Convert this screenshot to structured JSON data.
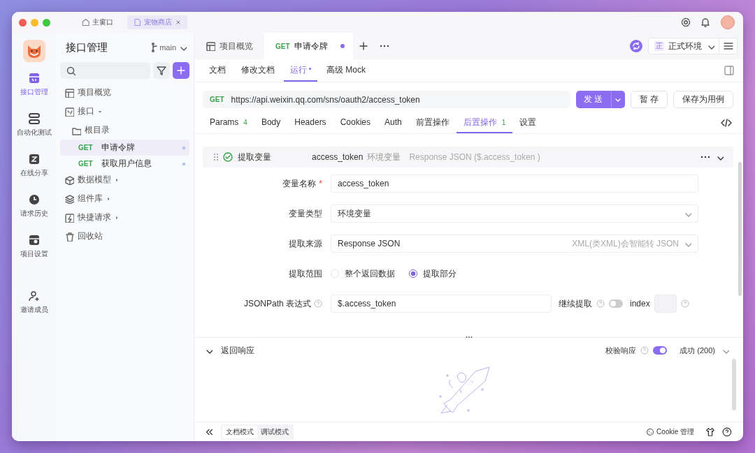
{
  "window": {
    "tabs": [
      {
        "label": "主窗口",
        "selected": false,
        "closable": false
      },
      {
        "label": "宠物商店",
        "selected": true,
        "closable": true
      }
    ]
  },
  "rail": {
    "items": [
      {
        "label": "接口管理",
        "selected": true
      },
      {
        "label": "自动化测试",
        "selected": false
      },
      {
        "label": "在线分享",
        "selected": false
      },
      {
        "label": "请求历史",
        "selected": false
      },
      {
        "label": "项目设置",
        "selected": false
      },
      {
        "label": "邀请成员",
        "selected": false
      }
    ]
  },
  "sidebar": {
    "title": "接口管理",
    "branch": "main",
    "tree": [
      {
        "kind": "overview",
        "label": "项目概览"
      },
      {
        "kind": "api",
        "label": "接口",
        "expanded": true,
        "children": [
          {
            "kind": "folder",
            "label": "根目录",
            "expanded": true,
            "children": [
              {
                "kind": "request",
                "method": "GET",
                "label": "申请令牌",
                "selected": true
              },
              {
                "kind": "request",
                "method": "GET",
                "label": "获取用户信息",
                "selected": false
              }
            ]
          }
        ]
      },
      {
        "kind": "model",
        "label": "数据模型",
        "expanded": false
      },
      {
        "kind": "component",
        "label": "组件库",
        "expanded": false
      },
      {
        "kind": "quick",
        "label": "快捷请求",
        "expanded": false
      },
      {
        "kind": "trash",
        "label": "回收站"
      }
    ]
  },
  "editor_tabs": [
    {
      "label": "项目概览",
      "selected": false,
      "modified": false
    },
    {
      "method": "GET",
      "label": "申请令牌",
      "selected": true,
      "modified": true
    }
  ],
  "environment": "正式环境",
  "environment_badge": "正",
  "sub_tabs": [
    {
      "label": "文档",
      "selected": false,
      "modified": false
    },
    {
      "label": "修改文档",
      "selected": false,
      "modified": false
    },
    {
      "label": "运行",
      "selected": true,
      "modified": true
    },
    {
      "label": "高级 Mock",
      "selected": false,
      "modified": false
    }
  ],
  "request": {
    "method": "GET",
    "url": "https://api.weixin.qq.com/sns/oauth2/access_token",
    "send": "发 送",
    "stash": "暂 存",
    "save_case": "保存为用例"
  },
  "request_tabs": [
    {
      "label": "Params",
      "count": "4",
      "selected": false
    },
    {
      "label": "Body",
      "selected": false
    },
    {
      "label": "Headers",
      "selected": false
    },
    {
      "label": "Cookies",
      "selected": false
    },
    {
      "label": "Auth",
      "selected": false
    },
    {
      "label": "前置操作",
      "selected": false
    },
    {
      "label": "后置操作",
      "count": "1",
      "selected": true
    },
    {
      "label": "设置",
      "selected": false
    }
  ],
  "processor": {
    "enabled": true,
    "title": "提取变量",
    "variable": "access_token",
    "scope": "环境变量",
    "source": "Response JSON ($.access_token )"
  },
  "form": [
    {
      "kind": "text",
      "label": "变量名称",
      "required_mark": "*",
      "value": "access_token"
    },
    {
      "kind": "select",
      "label": "变量类型",
      "value": "环境变量"
    },
    {
      "kind": "select",
      "label": "提取来源",
      "value": "Response JSON",
      "hint": "XML(类XML)会智能转 JSON"
    },
    {
      "kind": "radio",
      "label": "提取范围",
      "options": [
        {
          "label": "整个返回数据",
          "selected": false
        },
        {
          "label": "提取部分",
          "selected": true
        }
      ]
    },
    {
      "kind": "jsonpath",
      "label": "JSONPath 表达式",
      "value": "$.access_token",
      "continue_label": "继续提取",
      "continue_on": false,
      "index_label": "index"
    }
  ],
  "response": {
    "title": "返回响应",
    "expanded": true,
    "validate_label": "校验响应",
    "validate_on": true,
    "status": "成功 (200)"
  },
  "footer": {
    "modes": [
      {
        "label": "文档模式",
        "selected": true
      },
      {
        "label": "调试模式",
        "selected": false
      }
    ],
    "cookie": "Cookie 管理"
  }
}
